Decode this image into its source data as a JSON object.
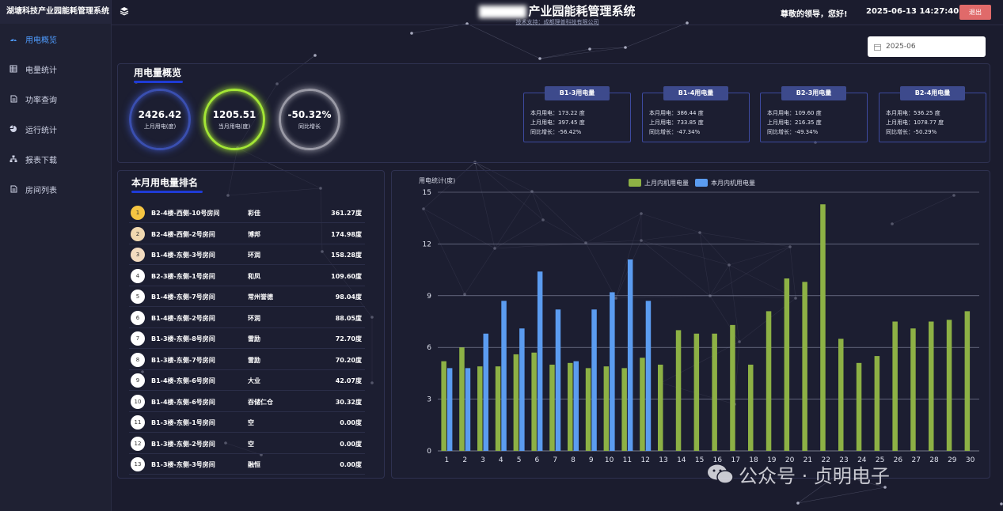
{
  "sidebar": {
    "brand": "湖塘科技产业园能耗管理系统",
    "items": [
      {
        "label": "用电概览",
        "icon": "dashboard-icon",
        "active": true
      },
      {
        "label": "电量统计",
        "icon": "table-icon",
        "active": false
      },
      {
        "label": "功率查询",
        "icon": "document-icon",
        "active": false
      },
      {
        "label": "运行统计",
        "icon": "pie-icon",
        "active": false
      },
      {
        "label": "报表下载",
        "icon": "org-chart-icon",
        "active": false
      },
      {
        "label": "房间列表",
        "icon": "document-icon",
        "active": false
      }
    ]
  },
  "header": {
    "title": "产业园能耗管理系统",
    "tech_support": "技术支持：成都理普科技有限公司",
    "greeting": "尊敬的领导，您好!",
    "datetime": "2025-06-13 14:27:40",
    "logout": "退出"
  },
  "month_picker": {
    "value": "2025-06"
  },
  "overview": {
    "title": "用电量概览",
    "rings": [
      {
        "value": "2426.42",
        "label": "上月用电(度)",
        "color": "#3a4fb0"
      },
      {
        "value": "1205.51",
        "label": "当月用电(度)",
        "color": "#a3e635"
      },
      {
        "value": "-50.32%",
        "label": "同比增长",
        "color": "#9a9aa6"
      }
    ],
    "cards": [
      {
        "title": "B1-3用电量",
        "this_month": "本月用电：173.22 度",
        "last_month": "上月用电：397.45 度",
        "yoy": "同比增长：-56.42%"
      },
      {
        "title": "B1-4用电量",
        "this_month": "本月用电：386.44 度",
        "last_month": "上月用电：733.85 度",
        "yoy": "同比增长：-47.34%"
      },
      {
        "title": "B2-3用电量",
        "this_month": "本月用电：109.60 度",
        "last_month": "上月用电：216.35 度",
        "yoy": "同比增长：-49.34%"
      },
      {
        "title": "B2-4用电量",
        "this_month": "本月用电：536.25 度",
        "last_month": "上月用电：1078.77 度",
        "yoy": "同比增长：-50.29%"
      }
    ]
  },
  "ranking": {
    "title": "本月用电量排名",
    "rows": [
      {
        "rank": "1",
        "room": "B2-4楼-西侧-10号房间",
        "tenant": "彩佳",
        "kwh": "361.27度",
        "badge": "#f5c542"
      },
      {
        "rank": "2",
        "room": "B2-4楼-西侧-2号房间",
        "tenant": "博邦",
        "kwh": "174.98度",
        "badge": "#f0d8b0"
      },
      {
        "rank": "3",
        "room": "B1-4楼-东侧-3号房间",
        "tenant": "环润",
        "kwh": "158.28度",
        "badge": "#f3dcc0"
      },
      {
        "rank": "4",
        "room": "B2-3楼-东侧-1号房间",
        "tenant": "和凤",
        "kwh": "109.60度",
        "badge": "#ffffff"
      },
      {
        "rank": "5",
        "room": "B1-4楼-东侧-7号房间",
        "tenant": "常州誉德",
        "kwh": "98.04度",
        "badge": "#ffffff"
      },
      {
        "rank": "6",
        "room": "B1-4楼-东侧-2号房间",
        "tenant": "环润",
        "kwh": "88.05度",
        "badge": "#ffffff"
      },
      {
        "rank": "7",
        "room": "B1-3楼-东侧-8号房间",
        "tenant": "雷励",
        "kwh": "72.70度",
        "badge": "#ffffff"
      },
      {
        "rank": "8",
        "room": "B1-3楼-东侧-7号房间",
        "tenant": "雷励",
        "kwh": "70.20度",
        "badge": "#ffffff"
      },
      {
        "rank": "9",
        "room": "B1-4楼-东侧-6号房间",
        "tenant": "大业",
        "kwh": "42.07度",
        "badge": "#ffffff"
      },
      {
        "rank": "10",
        "room": "B1-4楼-东侧-6号房间",
        "tenant": "吞储仁仓",
        "kwh": "30.32度",
        "badge": "#ffffff"
      },
      {
        "rank": "11",
        "room": "B1-3楼-东侧-1号房间",
        "tenant": "空",
        "kwh": "0.00度",
        "badge": "#ffffff"
      },
      {
        "rank": "12",
        "room": "B1-3楼-东侧-2号房间",
        "tenant": "空",
        "kwh": "0.00度",
        "badge": "#ffffff"
      },
      {
        "rank": "13",
        "room": "B1-3楼-东侧-3号房间",
        "tenant": "融恒",
        "kwh": "0.00度",
        "badge": "#ffffff"
      }
    ]
  },
  "chart_data": {
    "type": "bar",
    "ylabel": "用电统计(度)",
    "ylim": [
      0,
      15
    ],
    "yticks": [
      0,
      3,
      6,
      9,
      12,
      15
    ],
    "categories": [
      "1",
      "2",
      "3",
      "4",
      "5",
      "6",
      "7",
      "8",
      "9",
      "10",
      "11",
      "12",
      "13",
      "14",
      "15",
      "16",
      "17",
      "18",
      "19",
      "20",
      "21",
      "22",
      "23",
      "24",
      "25",
      "26",
      "27",
      "28",
      "29",
      "30"
    ],
    "legend_position": "top-center",
    "series": [
      {
        "name": "上月内机用电量",
        "color": "#8db145",
        "values": [
          5.2,
          6.0,
          4.9,
          4.9,
          5.6,
          5.7,
          5.0,
          5.1,
          4.8,
          4.9,
          4.8,
          5.4,
          5.0,
          7.0,
          6.8,
          6.8,
          7.3,
          5.0,
          8.1,
          10.0,
          9.8,
          14.3,
          6.5,
          5.1,
          5.5,
          7.5,
          7.1,
          7.5,
          7.6,
          8.1
        ]
      },
      {
        "name": "本月内机用电量",
        "color": "#5b9cf0",
        "values": [
          4.8,
          4.8,
          6.8,
          8.7,
          7.1,
          10.4,
          8.2,
          5.2,
          8.2,
          9.2,
          11.1,
          8.7,
          null,
          null,
          null,
          null,
          null,
          null,
          null,
          null,
          null,
          null,
          null,
          null,
          null,
          null,
          null,
          null,
          null,
          null
        ]
      }
    ]
  },
  "watermark": {
    "text": "公众号 · 贞明电子"
  }
}
